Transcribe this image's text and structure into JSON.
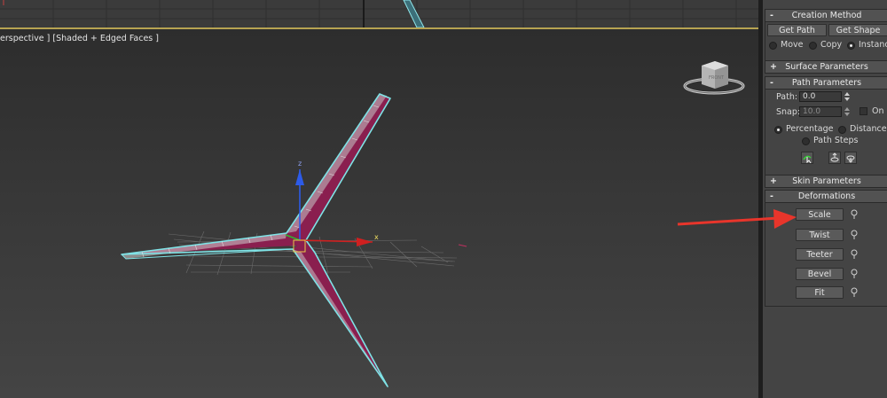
{
  "viewport": {
    "label": "erspective ] [Shaded + Edged Faces ]",
    "viewcube_label": "FRONT",
    "gizmo_axis_x": "x",
    "gizmo_axis_z": "z"
  },
  "panel": {
    "creation_method": {
      "title": "Creation Method",
      "get_path": "Get Path",
      "get_shape": "Get Shape",
      "options": [
        {
          "label": "Move",
          "selected": false
        },
        {
          "label": "Copy",
          "selected": false
        },
        {
          "label": "Instance",
          "selected": true
        }
      ]
    },
    "surface_parameters": {
      "title": "Surface Parameters",
      "toggle": "+"
    },
    "path_parameters": {
      "title": "Path Parameters",
      "toggle": "-",
      "path_label": "Path:",
      "path_value": "0.0",
      "snap_label": "Snap:",
      "snap_value": "10.0",
      "on_label": "On",
      "modes": [
        {
          "label": "Percentage",
          "selected": true
        },
        {
          "label": "Distance",
          "selected": false
        },
        {
          "label": "Path Steps",
          "selected": false
        }
      ]
    },
    "skin_parameters": {
      "title": "Skin Parameters",
      "toggle": "+"
    },
    "deformations": {
      "title": "Deformations",
      "toggle": "-",
      "buttons": [
        "Scale",
        "Twist",
        "Teeter",
        "Bevel",
        "Fit"
      ]
    }
  },
  "colors": {
    "accent_yellow": "#b7a352",
    "shape_fill": "#8a1f4f",
    "wire_cyan": "#7fe3e6",
    "annotation_red": "#e8352b"
  }
}
